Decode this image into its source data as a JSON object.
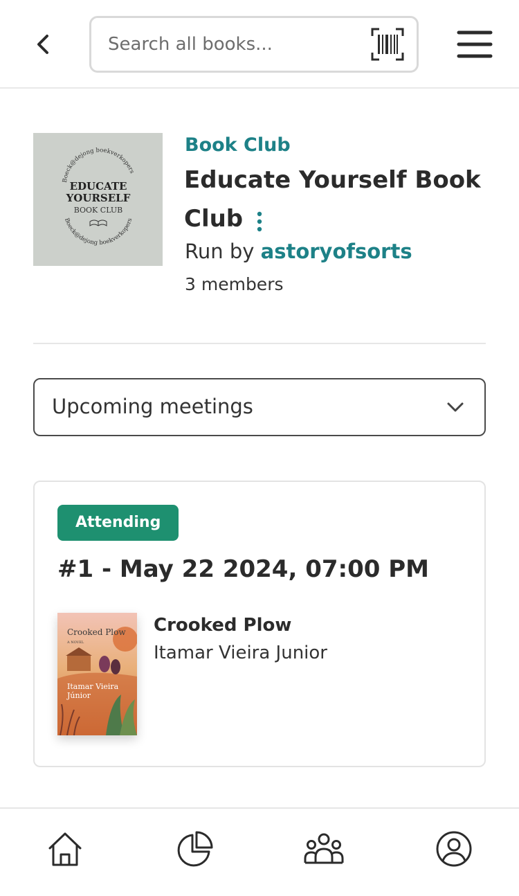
{
  "header": {
    "search": {
      "placeholder": "Search all books..."
    },
    "icons": {
      "back": "chevron-left-icon",
      "barcode": "barcode-scan-icon",
      "menu": "hamburger-menu-icon"
    }
  },
  "club": {
    "cover": {
      "top_text": "Boeck@dejong boekverkopers",
      "line1": "EDUCATE",
      "line2": "YOURSELF",
      "line3": "BOOK CLUB",
      "bottom_text": "Boeck@dejong boekverkopers"
    },
    "category": "Book Club",
    "title": "Educate Yourself Book Club",
    "run_by_prefix": "Run by ",
    "run_by_user": "astoryofsorts",
    "members": "3 members"
  },
  "meetings_select": {
    "selected": "Upcoming meetings"
  },
  "meeting": {
    "status": "Attending",
    "title": "#1 - May 22 2024, 07:00 PM",
    "book": {
      "title": "Crooked Plow",
      "author": "Itamar Vieira Junior",
      "cover": {
        "title": "Crooked Plow",
        "subtitle": "A NOVEL",
        "author_line1": "Itamar Vieira",
        "author_line2": "Júnior"
      }
    }
  },
  "bottom_nav": {
    "items": [
      {
        "icon": "home-icon"
      },
      {
        "icon": "pie-chart-icon"
      },
      {
        "icon": "community-icon"
      },
      {
        "icon": "profile-icon"
      }
    ]
  },
  "colors": {
    "accent_teal": "#1d8187",
    "attending_green": "#1e9070",
    "text_dark": "#2b2b2b"
  }
}
